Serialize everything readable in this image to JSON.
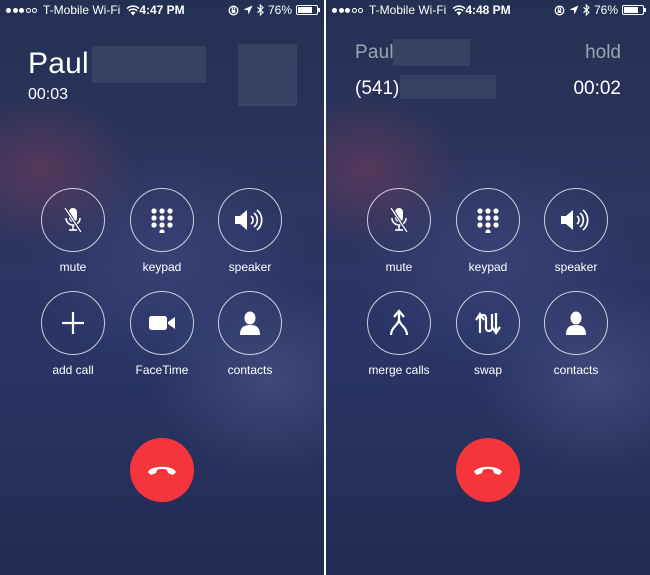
{
  "left_screen": {
    "status": {
      "carrier": "T-Mobile Wi-Fi",
      "time": "4:47 PM",
      "battery": "76%",
      "battery_level": 0.76
    },
    "caller_name": "Paul",
    "call_timer": "00:03",
    "buttons": {
      "mute": "mute",
      "keypad": "keypad",
      "speaker": "speaker",
      "add_call": "add call",
      "facetime": "FaceTime",
      "contacts": "contacts"
    }
  },
  "right_screen": {
    "status": {
      "carrier": "T-Mobile Wi-Fi",
      "time": "4:48 PM",
      "battery": "76%",
      "battery_level": 0.76
    },
    "caller_name": "Paul",
    "hold_label": "hold",
    "caller_number": "(541)",
    "call_timer": "00:02",
    "buttons": {
      "mute": "mute",
      "keypad": "keypad",
      "speaker": "speaker",
      "merge_calls": "merge calls",
      "swap": "swap",
      "contacts": "contacts"
    }
  },
  "colors": {
    "end_call": "#f4363c",
    "background": "#2a3566"
  },
  "icons": [
    "mute-icon",
    "keypad-icon",
    "speaker-icon",
    "add-call-icon",
    "facetime-icon",
    "contacts-icon",
    "merge-calls-icon",
    "swap-icon",
    "end-call-icon",
    "wifi-icon",
    "lock-rotation-icon",
    "location-icon",
    "bluetooth-icon",
    "battery-icon"
  ]
}
